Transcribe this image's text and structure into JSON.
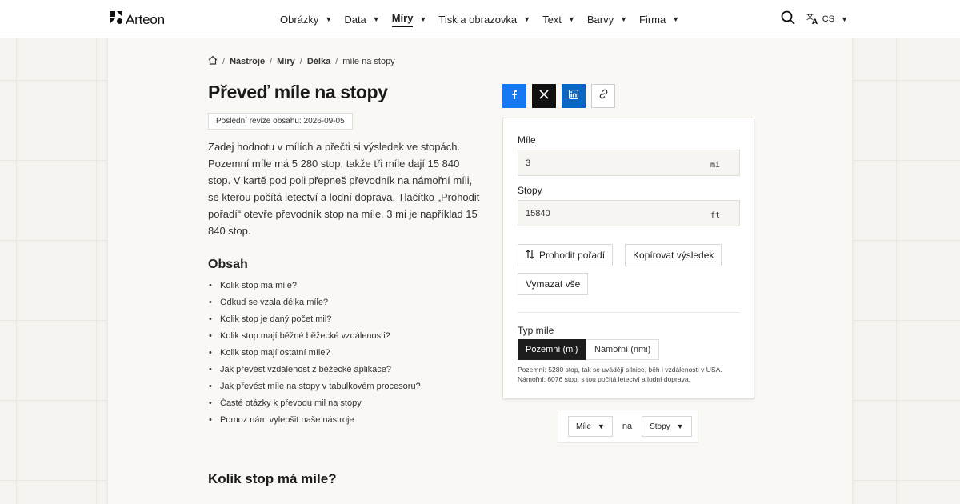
{
  "brand": {
    "name": "Arteon"
  },
  "nav": {
    "items": [
      {
        "label": "Obrázky",
        "active": false
      },
      {
        "label": "Data",
        "active": false
      },
      {
        "label": "Míry",
        "active": true
      },
      {
        "label": "Tisk a obrazovka",
        "active": false
      },
      {
        "label": "Text",
        "active": false
      },
      {
        "label": "Barvy",
        "active": false
      },
      {
        "label": "Firma",
        "active": false
      }
    ],
    "language": "CS"
  },
  "breadcrumb": {
    "items": [
      "Nástroje",
      "Míry",
      "Délka"
    ],
    "current": "míle na stopy"
  },
  "page": {
    "title": "Převeď míle na stopy",
    "revision": "Poslední revize obsahu: 2026-09-05",
    "intro": "Zadej hodnotu v mílích a přečti si výsledek ve stopách. Pozemní míle má 5 280 stop, takže tři míle dají 15 840 stop. V kartě pod poli přepneš převodník na námořní míli, se kterou počítá letectví a lodní doprava. Tlačítko „Prohodit pořadí“ otevře převodník stop na míle. 3 mi je například 15 840 stop."
  },
  "toc": {
    "title": "Obsah",
    "items": [
      "Kolik stop má míle?",
      "Odkud se vzala délka míle?",
      "Kolik stop je daný počet mil?",
      "Kolik stop mají běžné běžecké vzdálenosti?",
      "Kolik stop mají ostatní míle?",
      "Jak převést vzdálenost z běžecké aplikace?",
      "Jak převést míle na stopy v tabulkovém procesoru?",
      "Časté otázky k převodu mil na stopy",
      "Pomoz nám vylepšit naše nástroje"
    ]
  },
  "section": {
    "heading": "Kolik stop má míle?"
  },
  "converter": {
    "from": {
      "label": "Míle",
      "value": "3",
      "unit": "mi"
    },
    "to": {
      "label": "Stopy",
      "value": "15840",
      "unit": "ft"
    },
    "swap_label": "Prohodit pořadí",
    "copy_label": "Kopírovat výsledek",
    "clear_label": "Vymazat vše",
    "mile_type": {
      "label": "Typ míle",
      "options": [
        "Pozemní (mi)",
        "Námořní (nmi)"
      ],
      "selected": "Pozemní (mi)",
      "note": "Pozemní: 5280 stop, tak se uvádějí silnice, běh i vzdálenosti v USA. Námořní: 6076 stop, s tou počítá letectví a lodní doprava."
    }
  },
  "unit_switch": {
    "from": "Míle",
    "joiner": "na",
    "to": "Stopy"
  },
  "colors": {
    "facebook": "#1877f2",
    "x": "#111111",
    "linkedin": "#0a66c2",
    "dark_button": "#1d1d1d"
  }
}
